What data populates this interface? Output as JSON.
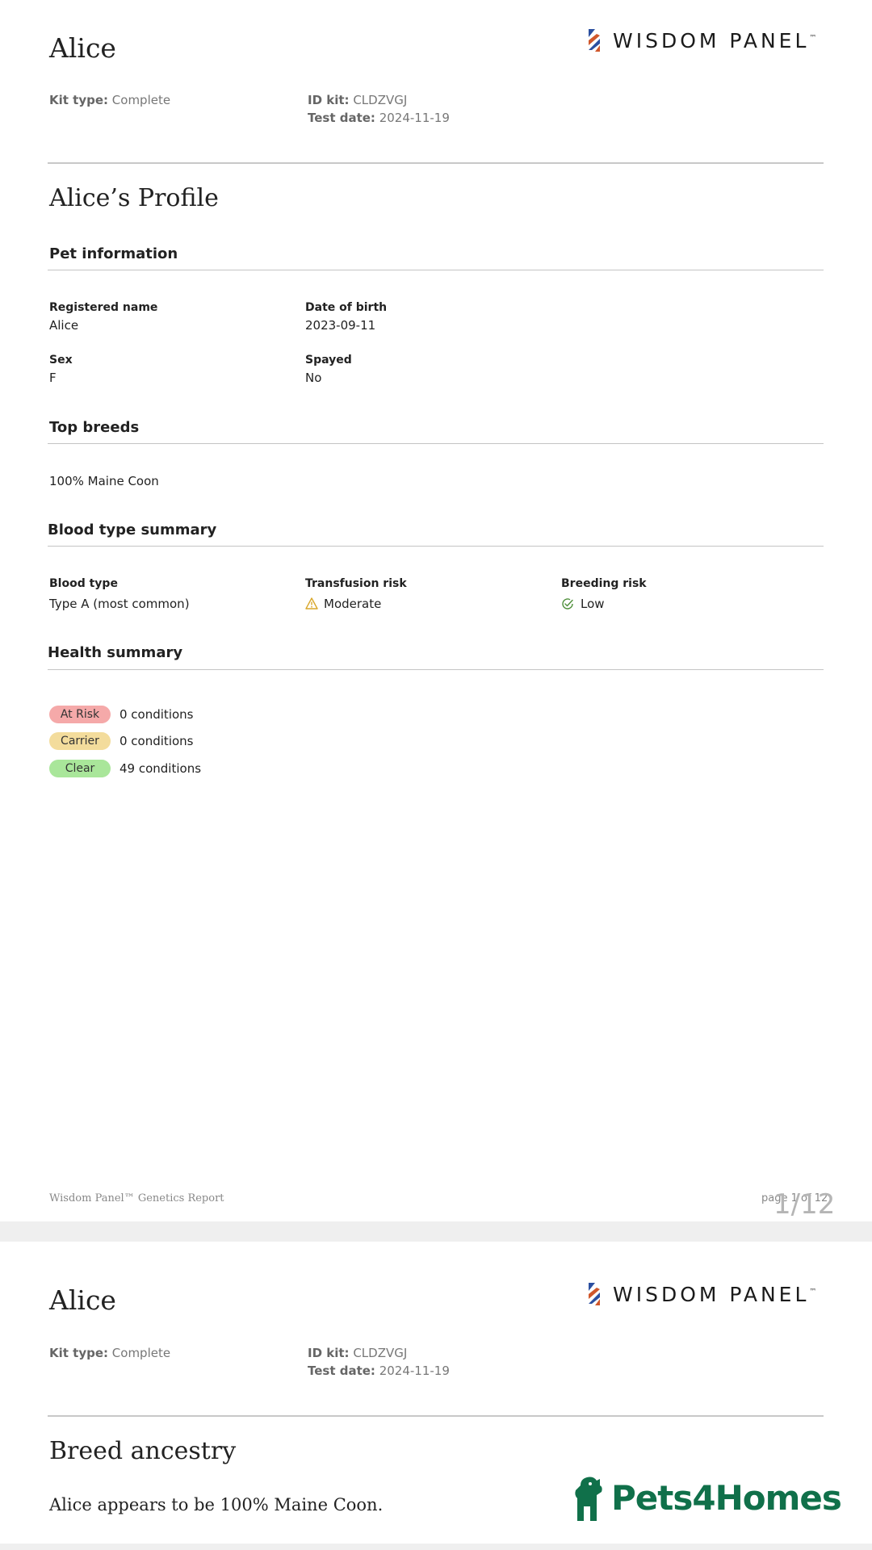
{
  "report": {
    "pet_name": "Alice",
    "brand": "WISDOM PANEL",
    "brand_tm": "™",
    "kit_type_label": "Kit type:",
    "kit_type": "Complete",
    "id_kit_label": "ID kit:",
    "id_kit": "CLDZVGJ",
    "test_date_label": "Test date:",
    "test_date": "2024-11-19"
  },
  "page1": {
    "profile_title": "Alice’s Profile",
    "pet_info": {
      "heading": "Pet information",
      "registered_name_label": "Registered name",
      "registered_name": "Alice",
      "dob_label": "Date of birth",
      "dob": "2023-09-11",
      "sex_label": "Sex",
      "sex": "F",
      "spayed_label": "Spayed",
      "spayed": "No"
    },
    "top_breeds": {
      "heading": "Top breeds",
      "value": "100% Maine Coon"
    },
    "blood": {
      "heading": "Blood type summary",
      "type_label": "Blood type",
      "type_value": "Type A (most common)",
      "transfusion_label": "Transfusion risk",
      "transfusion_value": "Moderate",
      "breeding_label": "Breeding risk",
      "breeding_value": "Low"
    },
    "health": {
      "heading": "Health summary",
      "rows": [
        {
          "badge": "At Risk",
          "count": "0 conditions",
          "color": "#f5a9a9"
        },
        {
          "badge": "Carrier",
          "count": "0 conditions",
          "color": "#f3dc9c"
        },
        {
          "badge": "Clear",
          "count": "49 conditions",
          "color": "#a9e69a"
        }
      ]
    },
    "footer_left": "Wisdom Panel™ Genetics Report",
    "footer_right": "page 1 of 12",
    "viewer_page_indicator": "1/12"
  },
  "page2": {
    "section_title": "Breed ancestry",
    "statement": "Alice appears to be 100% Maine Coon.",
    "watermark_logo": "Pets4Homes"
  },
  "colors": {
    "brand_blue": "#2b4fa0",
    "brand_orange": "#d0572b",
    "pets4homes_green": "#10704a",
    "warning_amber": "#d9a72b",
    "check_green": "#4e8f3a"
  }
}
